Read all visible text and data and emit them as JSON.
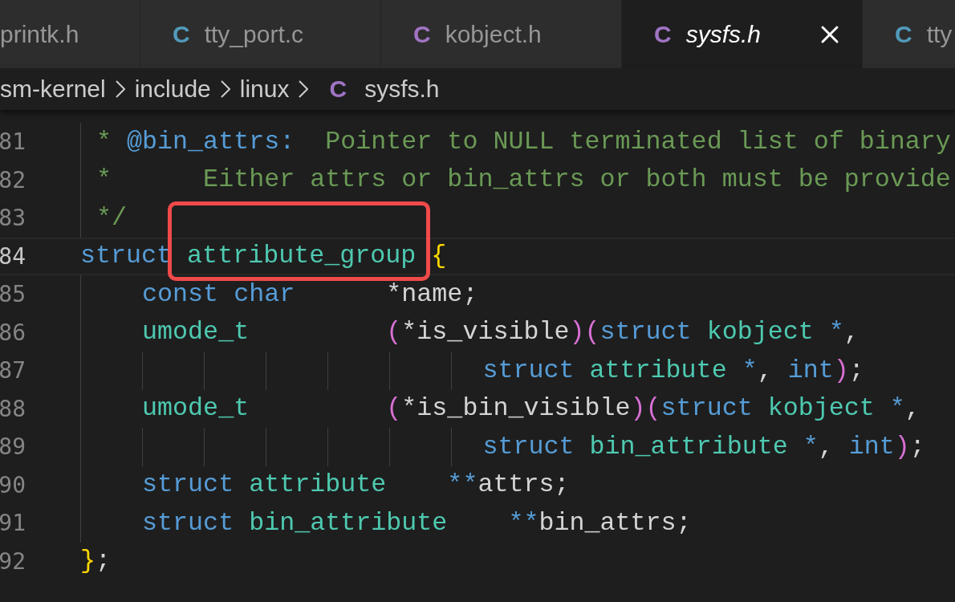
{
  "tabs": [
    {
      "label": "printk.h",
      "selected": false,
      "preview": false
    },
    {
      "icon": "C",
      "label": "tty_port.c",
      "selected": false,
      "preview": false,
      "color": "#519aba"
    },
    {
      "icon": "C",
      "label": "kobject.h",
      "selected": false,
      "preview": false,
      "color": "#a074c4"
    },
    {
      "icon": "C",
      "label": "sysfs.h",
      "selected": true,
      "preview": true,
      "color": "#a074c4"
    },
    {
      "icon": "C",
      "label": "tty",
      "selected": false,
      "preview": false,
      "color": "#519aba"
    }
  ],
  "breadcrumb": [
    {
      "kind": "folder",
      "label": "sm-kernel"
    },
    {
      "kind": "folder",
      "label": "include"
    },
    {
      "kind": "folder",
      "label": "linux"
    },
    {
      "kind": "file",
      "icon": "C",
      "color": "#a074c4",
      "label": "sysfs.h"
    }
  ],
  "lines": [
    {
      "number": "81",
      "active": false,
      "tokens": [
        {
          "kind": "comment",
          "text": " * "
        },
        {
          "kind": "doctag",
          "text": "@bin_attrs:"
        },
        {
          "kind": "comment",
          "text": "  Pointer to NULL terminated list of binary"
        }
      ]
    },
    {
      "number": "82",
      "active": false,
      "tokens": [
        {
          "kind": "comment",
          "text": " *      Either attrs or bin_attrs or both must be provide"
        }
      ]
    },
    {
      "number": "83",
      "active": false,
      "tokens": [
        {
          "kind": "comment",
          "text": " */"
        }
      ]
    },
    {
      "number": "84",
      "active": true,
      "tokens": [
        {
          "kind": "keyword",
          "text": "struct "
        },
        {
          "kind": "type",
          "text": "attribute_group",
          "outlined": true
        },
        {
          "kind": "brace",
          "text": " {"
        }
      ]
    },
    {
      "number": "85",
      "active": false,
      "tokens": [
        {
          "kind": "keyword",
          "text": "    const char"
        },
        {
          "kind": "plain",
          "text": "      *name;"
        }
      ]
    },
    {
      "number": "86",
      "active": false,
      "tokens": [
        {
          "kind": "type",
          "text": "    umode_t         "
        },
        {
          "kind": "paren",
          "text": "("
        },
        {
          "kind": "plain",
          "text": "*is_visible"
        },
        {
          "kind": "paren",
          "text": ")("
        },
        {
          "kind": "keyword",
          "text": "struct "
        },
        {
          "kind": "type",
          "text": "kobject"
        },
        {
          "kind": "keyword",
          "text": " *"
        },
        {
          "kind": "plain",
          "text": ","
        }
      ]
    },
    {
      "number": "87",
      "active": false,
      "tokens": [
        {
          "kind": "keyword",
          "text": "                          struct "
        },
        {
          "kind": "type",
          "text": "attribute"
        },
        {
          "kind": "keyword",
          "text": " *"
        },
        {
          "kind": "plain",
          "text": ", "
        },
        {
          "kind": "keyword",
          "text": "int"
        },
        {
          "kind": "paren",
          "text": ")"
        },
        {
          "kind": "plain",
          "text": ";"
        }
      ]
    },
    {
      "number": "88",
      "active": false,
      "tokens": [
        {
          "kind": "type",
          "text": "    umode_t         "
        },
        {
          "kind": "paren",
          "text": "("
        },
        {
          "kind": "plain",
          "text": "*is_bin_visible"
        },
        {
          "kind": "paren",
          "text": ")("
        },
        {
          "kind": "keyword",
          "text": "struct "
        },
        {
          "kind": "type",
          "text": "kobject"
        },
        {
          "kind": "keyword",
          "text": " *"
        },
        {
          "kind": "plain",
          "text": ","
        }
      ]
    },
    {
      "number": "89",
      "active": false,
      "tokens": [
        {
          "kind": "keyword",
          "text": "                          struct "
        },
        {
          "kind": "type",
          "text": "bin_attribute"
        },
        {
          "kind": "keyword",
          "text": " *"
        },
        {
          "kind": "plain",
          "text": ", "
        },
        {
          "kind": "keyword",
          "text": "int"
        },
        {
          "kind": "paren",
          "text": ")"
        },
        {
          "kind": "plain",
          "text": ";"
        }
      ]
    },
    {
      "number": "90",
      "active": false,
      "tokens": [
        {
          "kind": "keyword",
          "text": "    struct "
        },
        {
          "kind": "type",
          "text": "attribute"
        },
        {
          "kind": "keyword",
          "text": "    **"
        },
        {
          "kind": "plain",
          "text": "attrs;"
        }
      ]
    },
    {
      "number": "91",
      "active": false,
      "tokens": [
        {
          "kind": "keyword",
          "text": "    struct "
        },
        {
          "kind": "type",
          "text": "bin_attribute"
        },
        {
          "kind": "keyword",
          "text": "    **"
        },
        {
          "kind": "plain",
          "text": "bin_attrs;"
        }
      ]
    },
    {
      "number": "92",
      "active": false,
      "tokens": [
        {
          "kind": "brace",
          "text": "}"
        },
        {
          "kind": "plain",
          "text": ";"
        }
      ]
    }
  ]
}
